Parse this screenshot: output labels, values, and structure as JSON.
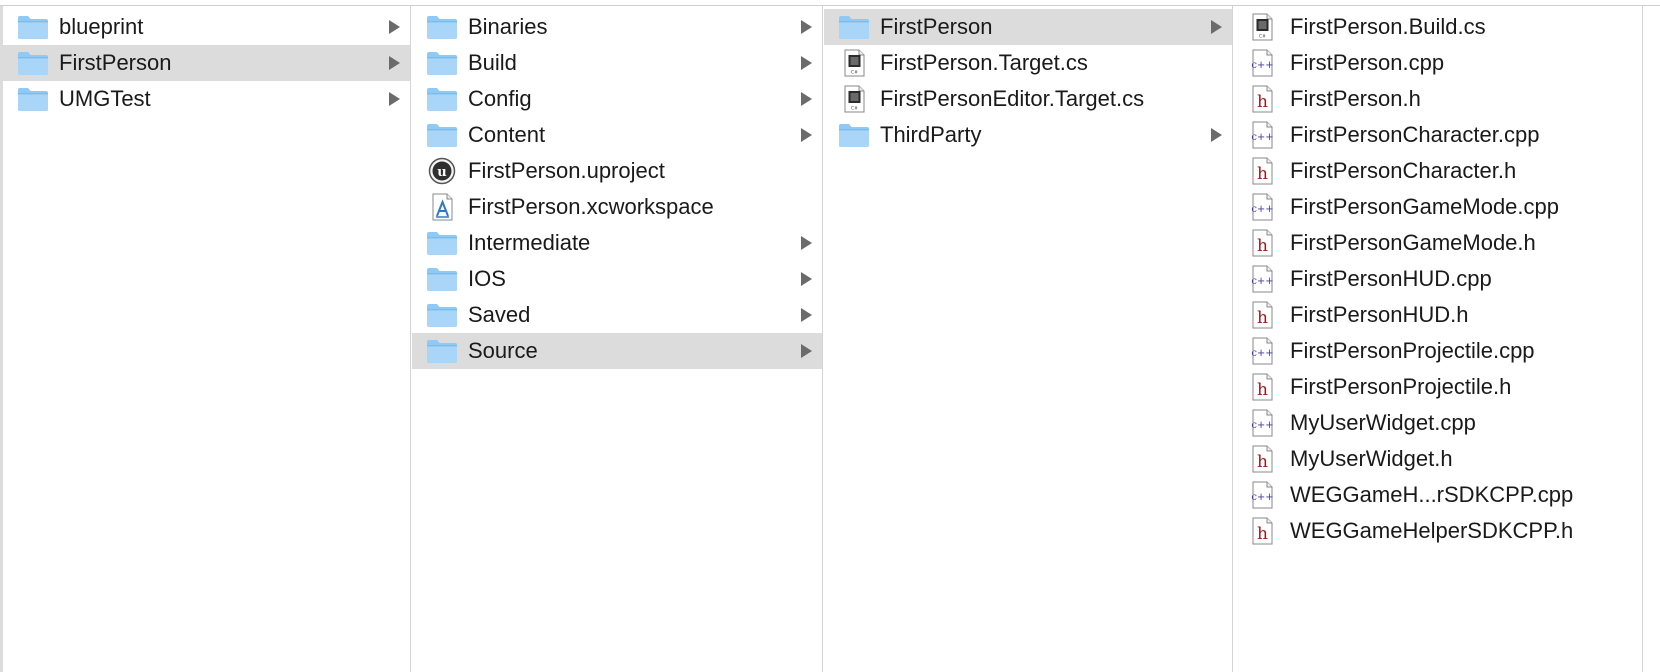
{
  "accent": {
    "folder_top": "#8fc9f5",
    "folder_body": "#a9d6f8",
    "selection": "#dcdcdc",
    "cpp_glyph": "#3c3c9c",
    "h_glyph": "#a01818"
  },
  "columns": [
    {
      "items": [
        {
          "name": "blueprint",
          "icon": "folder-icon",
          "arrow": true,
          "selected": false
        },
        {
          "name": "FirstPerson",
          "icon": "folder-icon",
          "arrow": true,
          "selected": true
        },
        {
          "name": "UMGTest",
          "icon": "folder-icon",
          "arrow": true,
          "selected": false
        }
      ]
    },
    {
      "items": [
        {
          "name": "Binaries",
          "icon": "folder-icon",
          "arrow": true,
          "selected": false
        },
        {
          "name": "Build",
          "icon": "folder-icon",
          "arrow": true,
          "selected": false
        },
        {
          "name": "Config",
          "icon": "folder-icon",
          "arrow": true,
          "selected": false
        },
        {
          "name": "Content",
          "icon": "folder-icon",
          "arrow": true,
          "selected": false
        },
        {
          "name": "FirstPerson.uproject",
          "icon": "unreal-project-icon",
          "arrow": false,
          "selected": false
        },
        {
          "name": "FirstPerson.xcworkspace",
          "icon": "xcode-workspace-icon",
          "arrow": false,
          "selected": false
        },
        {
          "name": "Intermediate",
          "icon": "folder-icon",
          "arrow": true,
          "selected": false
        },
        {
          "name": "IOS",
          "icon": "folder-icon",
          "arrow": true,
          "selected": false
        },
        {
          "name": "Saved",
          "icon": "folder-icon",
          "arrow": true,
          "selected": false
        },
        {
          "name": "Source",
          "icon": "folder-icon",
          "arrow": true,
          "selected": true
        }
      ]
    },
    {
      "items": [
        {
          "name": "FirstPerson",
          "icon": "folder-icon",
          "arrow": true,
          "selected": true
        },
        {
          "name": "FirstPerson.Target.cs",
          "icon": "csharp-file-icon",
          "arrow": false,
          "selected": false
        },
        {
          "name": "FirstPersonEditor.Target.cs",
          "icon": "csharp-file-icon",
          "arrow": false,
          "selected": false
        },
        {
          "name": "ThirdParty",
          "icon": "folder-icon",
          "arrow": true,
          "selected": false
        }
      ]
    },
    {
      "items": [
        {
          "name": "FirstPerson.Build.cs",
          "icon": "csharp-file-icon",
          "arrow": false,
          "selected": false
        },
        {
          "name": "FirstPerson.cpp",
          "icon": "cpp-file-icon",
          "arrow": false,
          "selected": false
        },
        {
          "name": "FirstPerson.h",
          "icon": "header-file-icon",
          "arrow": false,
          "selected": false
        },
        {
          "name": "FirstPersonCharacter.cpp",
          "icon": "cpp-file-icon",
          "arrow": false,
          "selected": false
        },
        {
          "name": "FirstPersonCharacter.h",
          "icon": "header-file-icon",
          "arrow": false,
          "selected": false
        },
        {
          "name": "FirstPersonGameMode.cpp",
          "icon": "cpp-file-icon",
          "arrow": false,
          "selected": false
        },
        {
          "name": "FirstPersonGameMode.h",
          "icon": "header-file-icon",
          "arrow": false,
          "selected": false
        },
        {
          "name": "FirstPersonHUD.cpp",
          "icon": "cpp-file-icon",
          "arrow": false,
          "selected": false
        },
        {
          "name": "FirstPersonHUD.h",
          "icon": "header-file-icon",
          "arrow": false,
          "selected": false
        },
        {
          "name": "FirstPersonProjectile.cpp",
          "icon": "cpp-file-icon",
          "arrow": false,
          "selected": false
        },
        {
          "name": "FirstPersonProjectile.h",
          "icon": "header-file-icon",
          "arrow": false,
          "selected": false
        },
        {
          "name": "MyUserWidget.cpp",
          "icon": "cpp-file-icon",
          "arrow": false,
          "selected": false
        },
        {
          "name": "MyUserWidget.h",
          "icon": "header-file-icon",
          "arrow": false,
          "selected": false
        },
        {
          "name": "WEGGameH...rSDKCPP.cpp",
          "icon": "cpp-file-icon",
          "arrow": false,
          "selected": false
        },
        {
          "name": "WEGGameHelperSDKCPP.h",
          "icon": "header-file-icon",
          "arrow": false,
          "selected": false
        }
      ]
    }
  ]
}
